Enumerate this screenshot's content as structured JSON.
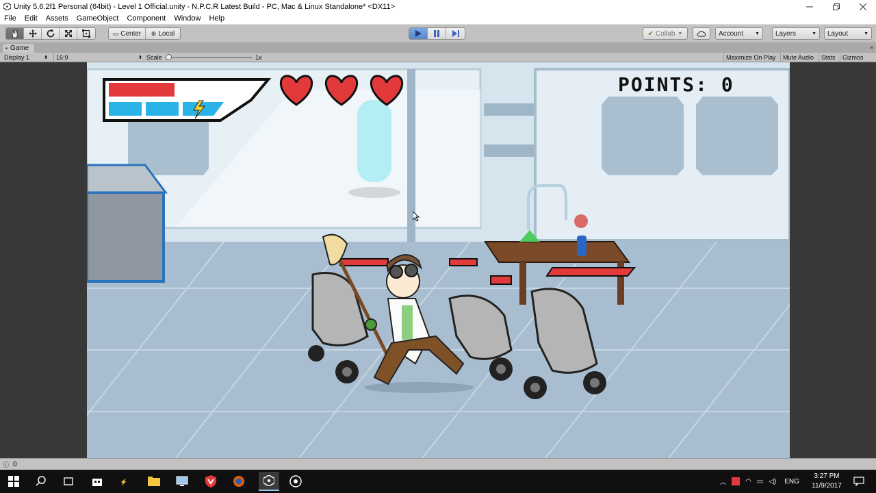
{
  "window": {
    "title": "Unity 5.6.2f1 Personal (64bit) - Level 1 Official.unity - N.P.C.R Latest Build - PC, Mac & Linux Standalone* <DX11>",
    "controls": [
      "minimize",
      "restore",
      "close"
    ]
  },
  "menu": [
    "File",
    "Edit",
    "Assets",
    "GameObject",
    "Component",
    "Window",
    "Help"
  ],
  "toolbar": {
    "transform_tools": [
      "hand-icon",
      "move-icon",
      "rotate-icon",
      "scale-icon",
      "rect-icon"
    ],
    "pivot_label": "Center",
    "space_label": "Local",
    "collab_label": "Collab",
    "account_label": "Account",
    "layers_label": "Layers",
    "layout_label": "Layout"
  },
  "game_panel": {
    "tab_label": "Game",
    "display_label": "Display 1",
    "aspect_label": "16:9",
    "scale_label": "Scale",
    "scale_value": "1x",
    "scale_level": 0.0,
    "maximize_label": "Maximize On Play",
    "mute_label": "Mute Audio",
    "stats_label": "Stats",
    "gizmos_label": "Gizmos"
  },
  "hud": {
    "points_text": "POINTS: 0",
    "health_fraction": 0.42,
    "energy_segments": 3,
    "hearts": 3
  },
  "statusbar": {
    "count": "0"
  },
  "taskbar": {
    "language": "ENG",
    "time": "3:27 PM",
    "date": "11/9/2017"
  },
  "colors": {
    "unity_gray": "#c2c2c2",
    "play_blue": "#5a89cc",
    "health_red": "#e23a3a",
    "energy_blue": "#29b3e6",
    "lab_wall": "#d4e3ec",
    "lab_floor": "#a9bfd1"
  }
}
